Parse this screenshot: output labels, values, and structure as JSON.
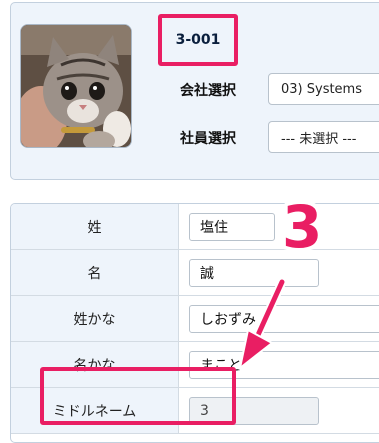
{
  "employee": {
    "code": "3-001",
    "company_label": "会社選択",
    "company_value": "03) Systems",
    "employee_label": "社員選択",
    "employee_value": "--- 未選択 ---"
  },
  "form": {
    "rows": [
      {
        "label": "姓",
        "value": "塩住"
      },
      {
        "label": "名",
        "value": "誠"
      },
      {
        "label": "姓かな",
        "value": "しおずみ"
      },
      {
        "label": "名かな",
        "value": "まこと"
      },
      {
        "label": "ミドルネーム",
        "value": "3"
      }
    ]
  },
  "annotation": {
    "step_number": "3",
    "color": "#e91e63"
  }
}
